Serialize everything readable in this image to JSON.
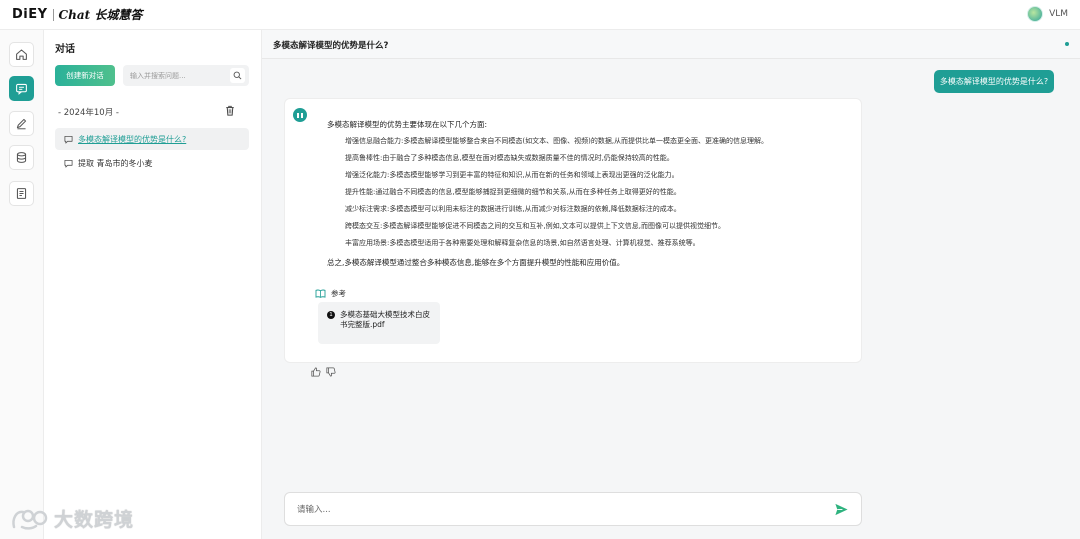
{
  "brand": {
    "logo_left": "DiEY",
    "logo_right": "Chat 长城慧答"
  },
  "user": {
    "name": "VLM"
  },
  "sidebar": {
    "title": "对话",
    "new_chat_label": "创建新对话",
    "search_placeholder": "输入并搜索问题...",
    "group_label": "- 2024年10月 -",
    "conversations": [
      {
        "title": "多模态解译模型的优势是什么?",
        "active": true
      },
      {
        "title": "提取 青岛市的冬小麦",
        "active": false
      }
    ]
  },
  "chat": {
    "title": "多模态解译模型的优势是什么?",
    "user_message": "多模态解译模型的优势是什么?",
    "answer": {
      "intro": "多模态解译模型的优势主要体现在以下几个方面:",
      "points": [
        "增强信息融合能力:多模态解译模型能够整合来自不同模态(如文本、图像、视频)的数据,从而提供比单一模态更全面、更准确的信息理解。",
        "提高鲁棒性:由于融合了多种模态信息,模型在面对模态缺失或数据质量不佳的情况时,仍能保持较高的性能。",
        "增强泛化能力:多模态模型能够学习到更丰富的特征和知识,从而在新的任务和领域上表现出更强的泛化能力。",
        "提升性能:通过融合不同模态的信息,模型能够捕捉到更细微的细节和关系,从而在多种任务上取得更好的性能。",
        "减少标注需求:多模态模型可以利用未标注的数据进行训练,从而减少对标注数据的依赖,降低数据标注的成本。",
        "跨模态交互:多模态解译模型能够促进不同模态之间的交互和互补,例如,文本可以提供上下文信息,而图像可以提供视觉细节。",
        "丰富应用场景:多模态模型适用于各种需要处理和解释复杂信息的场景,如自然语言处理、计算机视觉、推荐系统等。"
      ],
      "summary": "总之,多模态解译模型通过整合多种模态信息,能够在多个方面提升模型的性能和应用价值。",
      "reference_heading": "参考",
      "references": [
        {
          "index": "1",
          "title": "多模态基础大模型技术白皮书完整版.pdf"
        }
      ]
    },
    "input_placeholder": "请输入..."
  },
  "watermark": {
    "text": "大数跨境"
  },
  "colors": {
    "accent": "#1f9e95",
    "accent_gradient_end": "#4fc08d"
  },
  "icons": {
    "rail": [
      "home-icon",
      "chat-icon",
      "edit-icon",
      "database-icon",
      "document-icon"
    ],
    "search": "search-icon",
    "delete": "trash-icon",
    "feedback": [
      "thumbs-up-icon",
      "thumbs-down-icon"
    ],
    "send": "send-icon"
  }
}
